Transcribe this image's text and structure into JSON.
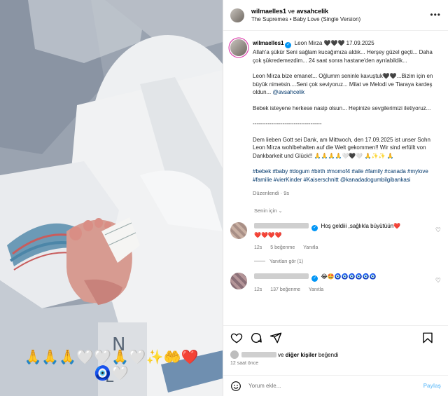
{
  "photo": {
    "emoji_row_1": "🙏🙏🙏🤍🤍🙏🤍✨🤲❤️",
    "emoji_row_2": "🧿🤍"
  },
  "header": {
    "user1": "wilmaelles1",
    "and": " ve ",
    "user2": "avsahcelik",
    "music": "The Supremes • Baby Love (Single Version)"
  },
  "caption": {
    "username": "wilmaelles1",
    "line1_rest": "Leon Mirza 🖤🖤🖤 17.09.2025",
    "para1": "Allah'a şükür Seni sağlam kucağımıza aldık... Herşey güzel geçti... Daha çok şükredemezdim... 24 saat sonra hastane'den ayrılabildik...",
    "para2a": "Leon Mirza bize emanet... Oğlumm seninle kavuştuk🖤🖤...Bizim için en büyük nimetsin....Seni çok seviyoruz... Milat ve Melodi ve Tiaraya kardeş oldun... ",
    "para2_mention": "@avsahcelik",
    "para3": "Bebek isteyene herkese nasip olsun... Hepinize sevgilerimizi iletiyoruz...",
    "separator": "-------------------------------------",
    "para4": "Dem lieben Gott sei Dank, am Mittwoch, den 17.09.2025 ist unser Sohn Leon Mirza wohlbehalten auf die Welt gekommen!! Wir sind erfüllt von Dankbarkeit und Glück!! 🙏🙏🙏🙏🤍🖤🤍 🙏✨✨ 🙏",
    "hashtags": "#bebek #baby #dogum #birth #momof4 #aile #family #canada #mylove #familie #vierKinder #Kaiserschnitt @kanadadogumbilgibankasi",
    "meta": "Düzenlendi · 9s"
  },
  "translate_label": "Senin için",
  "comments": [
    {
      "text": "Hoş geldiii ,sağlıkla büyütüün❤️",
      "text2": "❤️❤️❤️❤️",
      "time": "12s",
      "likes": "5 beğenme",
      "reply": "Yanıtla",
      "replies": "Yanıtları gör (1)"
    },
    {
      "text": "😂🤩🧿🧿🧿🧿🧿🧿",
      "time": "12s",
      "likes": "137 beğenme",
      "reply": "Yanıtla"
    }
  ],
  "likes_text": "ve diğer kişiler beğendi",
  "likes_bold": "diğer kişiler",
  "time_ago": "12 saat önce",
  "comment_input": {
    "placeholder": "Yorum ekle..."
  },
  "post_label": "Paylaş"
}
